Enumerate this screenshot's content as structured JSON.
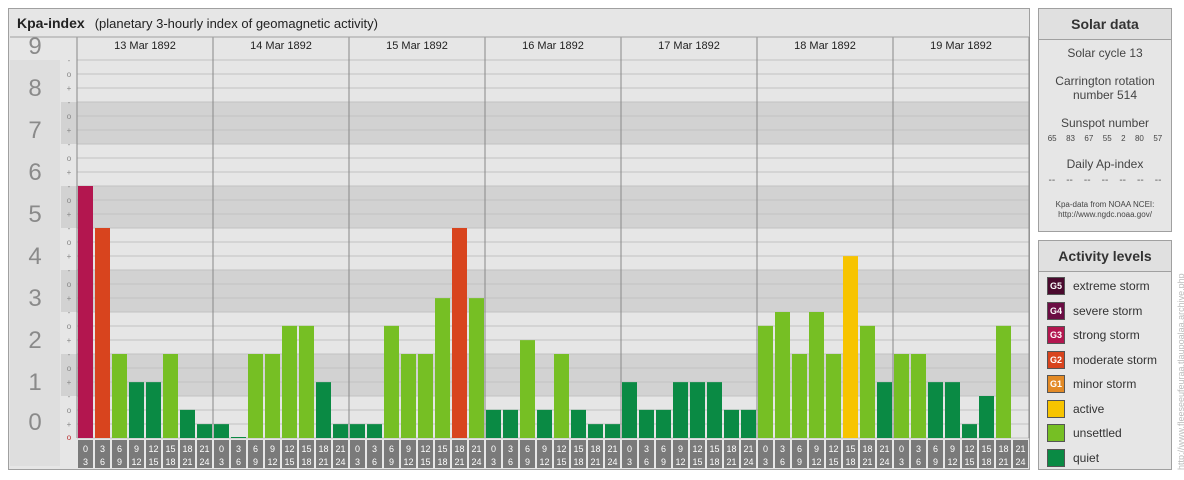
{
  "title": "Kpa-index",
  "subtitle": "(planetary 3-hourly index of geomagnetic activity)",
  "chart_data": {
    "type": "bar",
    "title": "Kpa-index",
    "subtitle": "(planetary 3-hourly index of geomagnetic activity)",
    "ylim": [
      0,
      9
    ],
    "y_ticks": [
      "0",
      "1",
      "2",
      "3",
      "4",
      "5",
      "6",
      "7",
      "8",
      "9"
    ],
    "minor_labels": [
      "+",
      "o",
      "-"
    ],
    "days": [
      "13 Mar 1892",
      "14 Mar 1892",
      "15 Mar 1892",
      "16 Mar 1892",
      "17 Mar 1892",
      "18 Mar 1892",
      "19 Mar 1892"
    ],
    "interval_labels": [
      [
        "0",
        "3"
      ],
      [
        "3",
        "6"
      ],
      [
        "6",
        "9"
      ],
      [
        "9",
        "12"
      ],
      [
        "12",
        "15"
      ],
      [
        "15",
        "18"
      ],
      [
        "18",
        "21"
      ],
      [
        "21",
        "24"
      ]
    ],
    "values": [
      [
        6.0,
        5.0,
        2.0,
        1.33,
        1.33,
        2.0,
        0.67,
        0.33
      ],
      [
        0.33,
        0.0,
        2.0,
        2.0,
        2.67,
        2.67,
        1.33,
        0.33
      ],
      [
        0.33,
        0.33,
        2.67,
        2.0,
        2.0,
        3.33,
        5.0,
        3.33
      ],
      [
        0.67,
        0.67,
        2.33,
        0.67,
        2.0,
        0.67,
        0.33,
        0.33
      ],
      [
        1.33,
        0.67,
        0.67,
        1.33,
        1.33,
        1.33,
        0.67,
        0.67
      ],
      [
        2.67,
        3.0,
        2.0,
        3.0,
        2.0,
        4.33,
        2.67,
        1.33
      ],
      [
        2.0,
        2.0,
        1.33,
        1.33,
        0.33,
        1.0,
        2.67
      ]
    ],
    "levels": [
      [
        5,
        4,
        1,
        0,
        0,
        1,
        0,
        0
      ],
      [
        0,
        0,
        1,
        1,
        1,
        1,
        0,
        0
      ],
      [
        0,
        0,
        1,
        1,
        1,
        1,
        4,
        1
      ],
      [
        0,
        0,
        1,
        0,
        1,
        0,
        0,
        0
      ],
      [
        0,
        0,
        0,
        0,
        0,
        0,
        0,
        0
      ],
      [
        1,
        1,
        1,
        1,
        1,
        2,
        1,
        0
      ],
      [
        1,
        1,
        0,
        0,
        0,
        0,
        1
      ]
    ],
    "level_colors": [
      "#0a8a44",
      "#76bf24",
      "#f7c400",
      "#e38a26",
      "#d8441e",
      "#b3164f",
      "#6b0d44",
      "#4a0a2e"
    ],
    "colors": {
      "band_light": "#e6e6e6",
      "band_dark": "#d2d2d2",
      "axis_bg": "#7a7a7a",
      "axis_text": "#ffffff",
      "day_line": "#888888",
      "number_text": "#8a8a8a"
    }
  },
  "solar": {
    "header": "Solar data",
    "cycle": "Solar cycle 13",
    "carrington_line1": "Carrington rotation",
    "carrington_line2": "number 514",
    "sunspot_label": "Sunspot number",
    "sunspots": [
      "65",
      "83",
      "67",
      "55",
      "2",
      "80",
      "57"
    ],
    "ap_label": "Daily Ap-index",
    "ap_values": [
      "--",
      "--",
      "--",
      "--",
      "--",
      "--",
      "--"
    ],
    "source_line1": "Kpa-data from NOAA NCEI:",
    "source_line2": "http://www.ngdc.noaa.gov/"
  },
  "activity": {
    "header": "Activity levels",
    "items": [
      {
        "code": "G5",
        "label": "extreme storm",
        "color": "#4a0a2e"
      },
      {
        "code": "G4",
        "label": "severe storm",
        "color": "#6b0d44"
      },
      {
        "code": "G3",
        "label": "strong storm",
        "color": "#b3164f"
      },
      {
        "code": "G2",
        "label": "moderate storm",
        "color": "#d8441e"
      },
      {
        "code": "G1",
        "label": "minor storm",
        "color": "#e38a26"
      },
      {
        "code": "",
        "label": "active",
        "color": "#f7c400"
      },
      {
        "code": "",
        "label": "unsettled",
        "color": "#76bf24"
      },
      {
        "code": "",
        "label": "quiet",
        "color": "#0a8a44"
      }
    ]
  },
  "watermark": "http://www.fleeseeufeuraa.tlaupoalaa.archive.php"
}
